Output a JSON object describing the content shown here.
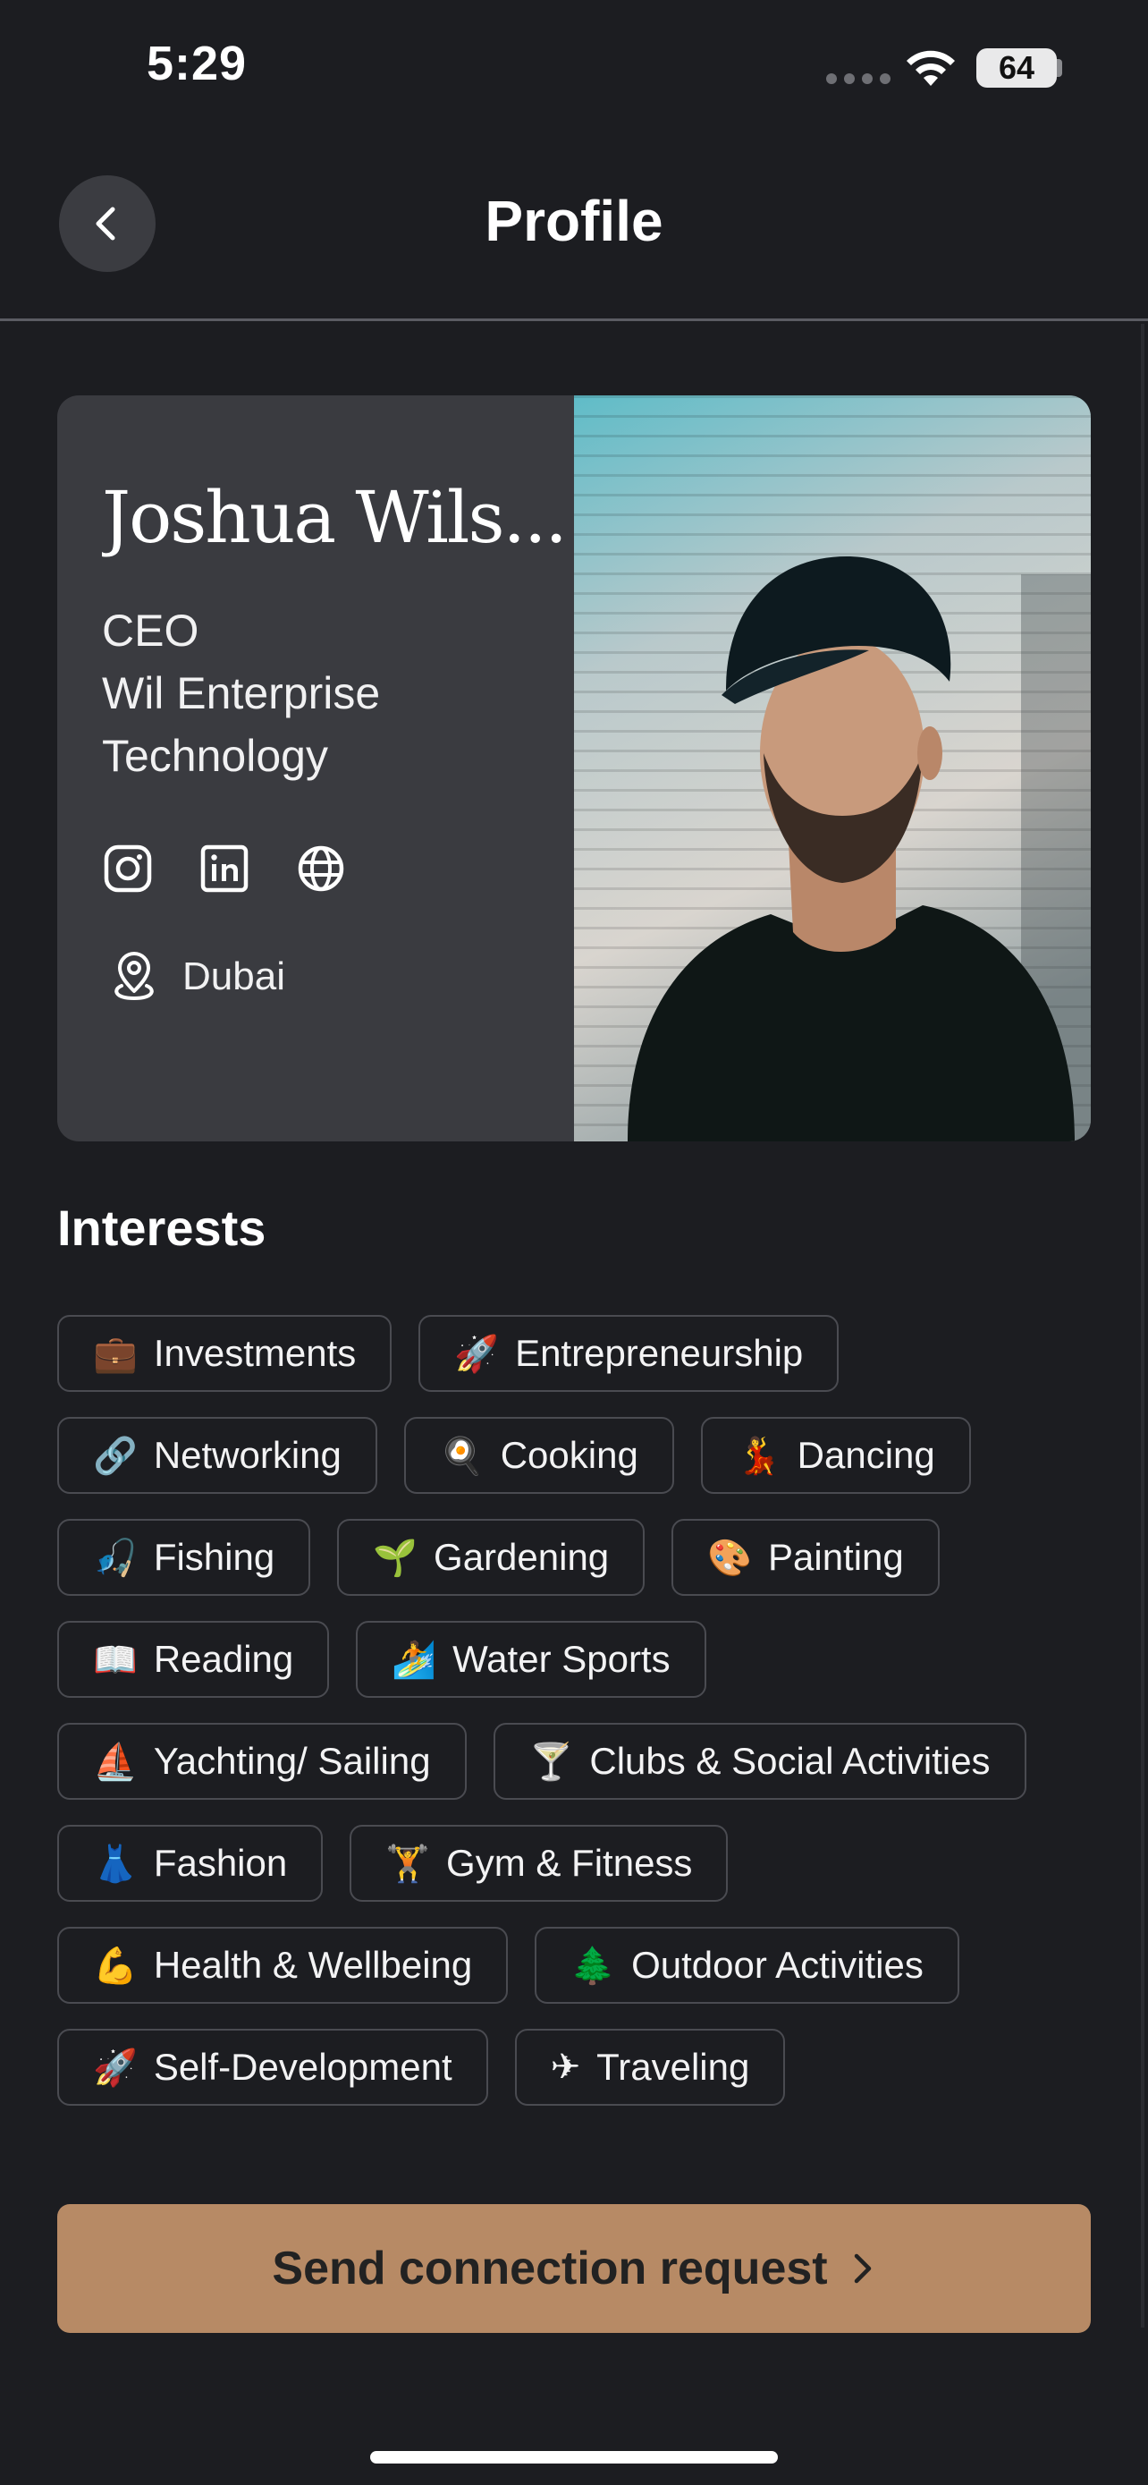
{
  "status_bar": {
    "time": "5:29",
    "battery": "64"
  },
  "header": {
    "title": "Profile",
    "back_icon": "chevron-left-icon"
  },
  "profile": {
    "name": "Joshua Wils...",
    "role_lines": [
      "CEO",
      "Wil Enterprise",
      "Technology"
    ],
    "social_icons": [
      "instagram-icon",
      "linkedin-icon",
      "globe-icon"
    ],
    "location": "Dubai",
    "location_icon": "location-pin-icon"
  },
  "interests": {
    "title": "Interests",
    "items": [
      {
        "emoji": "💼",
        "label": "Investments"
      },
      {
        "emoji": "🚀",
        "label": "Entrepreneurship"
      },
      {
        "emoji": "🔗",
        "label": "Networking"
      },
      {
        "emoji": "🍳",
        "label": "Cooking"
      },
      {
        "emoji": "💃",
        "label": "Dancing"
      },
      {
        "emoji": "🎣",
        "label": "Fishing"
      },
      {
        "emoji": "🌱",
        "label": "Gardening"
      },
      {
        "emoji": "🎨",
        "label": "Painting"
      },
      {
        "emoji": "📖",
        "label": "Reading"
      },
      {
        "emoji": "🏄",
        "label": "Water Sports"
      },
      {
        "emoji": "⛵",
        "label": "Yachting/ Sailing"
      },
      {
        "emoji": "🍸",
        "label": "Clubs & Social Activities"
      },
      {
        "emoji": "👗",
        "label": "Fashion"
      },
      {
        "emoji": "🏋",
        "label": "Gym & Fitness"
      },
      {
        "emoji": "💪",
        "label": "Health & Wellbeing"
      },
      {
        "emoji": "🌲",
        "label": "Outdoor Activities"
      },
      {
        "emoji": "🚀",
        "label": "Self-Development"
      },
      {
        "emoji": "✈",
        "label": "Traveling"
      }
    ]
  },
  "cta": {
    "label": "Send connection request",
    "icon": "chevron-right-icon"
  },
  "colors": {
    "background": "#1c1d21",
    "card": "#3a3b40",
    "accent": "#b78a65"
  }
}
